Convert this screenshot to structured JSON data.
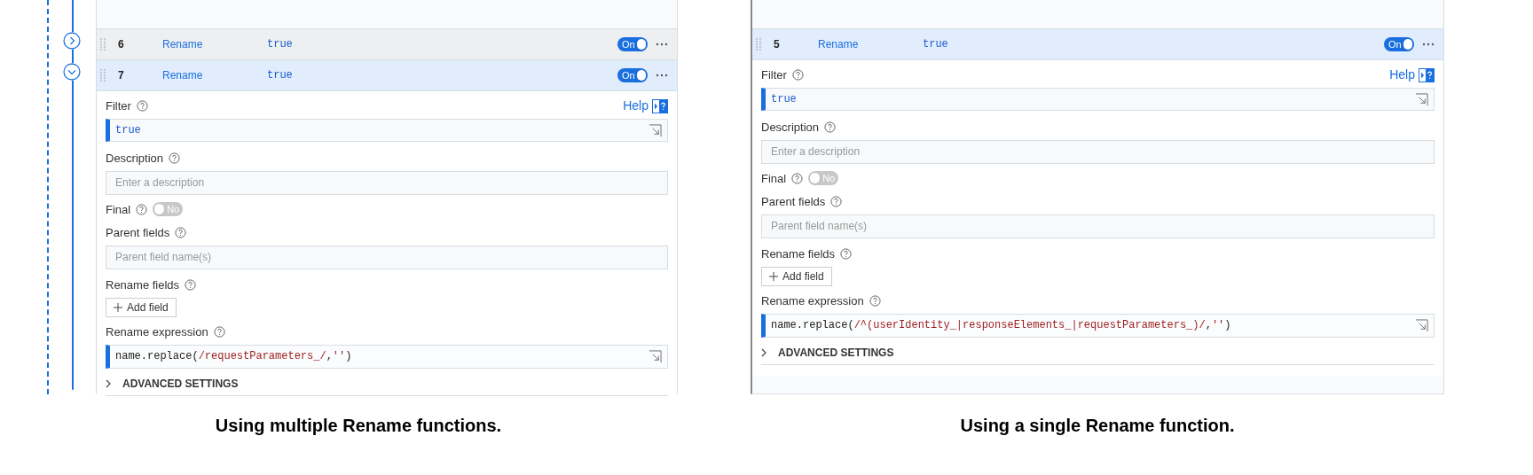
{
  "panels": [
    {
      "kind": "timeline",
      "functions": [
        {
          "number": "6",
          "name": "Rename",
          "filter": "true",
          "toggle": "On",
          "on": true,
          "expanded": false
        },
        {
          "number": "7",
          "name": "Rename",
          "filter": "true",
          "toggle": "On",
          "on": true,
          "expanded": true
        }
      ],
      "editor": {
        "filter_label": "Filter",
        "help": "Help",
        "filter_value": "true",
        "description_label": "Description",
        "description_placeholder": "Enter a description",
        "final_label": "Final",
        "final_toggle": "No",
        "final_on": false,
        "parent_label": "Parent fields",
        "parent_placeholder": "Parent field name(s)",
        "rename_fields_label": "Rename fields",
        "add_field": "Add field",
        "expression_label": "Rename expression",
        "expression": [
          {
            "kind": "code",
            "text": "name.replace("
          },
          {
            "kind": "string",
            "text": "/requestParameters_/"
          },
          {
            "kind": "code",
            "text": ","
          },
          {
            "kind": "string",
            "text": "''"
          },
          {
            "kind": "code",
            "text": ")"
          }
        ],
        "advanced": "ADVANCED SETTINGS"
      },
      "caption": "Using multiple Rename functions."
    },
    {
      "kind": "plain",
      "functions": [
        {
          "number": "5",
          "name": "Rename",
          "filter": "true",
          "toggle": "On",
          "on": true,
          "expanded": true
        }
      ],
      "editor": {
        "filter_label": "Filter",
        "help": "Help",
        "filter_value": "true",
        "description_label": "Description",
        "description_placeholder": "Enter a description",
        "final_label": "Final",
        "final_toggle": "No",
        "final_on": false,
        "parent_label": "Parent fields",
        "parent_placeholder": "Parent field name(s)",
        "rename_fields_label": "Rename fields",
        "add_field": "Add field",
        "expression_label": "Rename expression",
        "expression": [
          {
            "kind": "code",
            "text": "name.replace("
          },
          {
            "kind": "string",
            "text": "/^(userIdentity_|responseElements_|requestParameters_)/"
          },
          {
            "kind": "code",
            "text": ","
          },
          {
            "kind": "string",
            "text": "''"
          },
          {
            "kind": "code",
            "text": ")"
          }
        ],
        "advanced": "ADVANCED SETTINGS"
      },
      "caption": "Using a single Rename function."
    }
  ]
}
